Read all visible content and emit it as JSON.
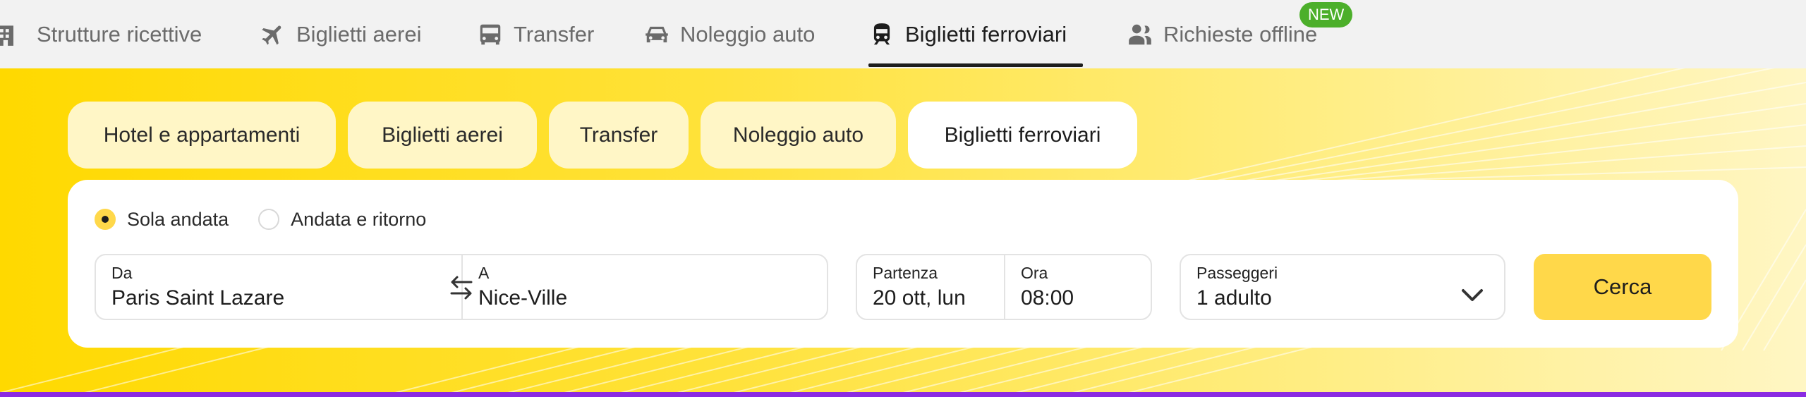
{
  "topnav": {
    "items": [
      {
        "label": "Strutture ricettive",
        "icon": "hotel-icon"
      },
      {
        "label": "Biglietti aerei",
        "icon": "airplane-icon"
      },
      {
        "label": "Transfer",
        "icon": "shuttle-icon"
      },
      {
        "label": "Noleggio auto",
        "icon": "car-icon"
      },
      {
        "label": "Biglietti ferroviari",
        "icon": "train-icon",
        "active": true
      },
      {
        "label": "Richieste offline",
        "icon": "offline-request-icon"
      }
    ],
    "new_badge": "NEW"
  },
  "tabs": [
    {
      "label": "Hotel e appartamenti"
    },
    {
      "label": "Biglietti aerei"
    },
    {
      "label": "Transfer"
    },
    {
      "label": "Noleggio auto"
    },
    {
      "label": "Biglietti ferroviari",
      "active": true
    }
  ],
  "trip_type": {
    "one_way": "Sola andata",
    "round_trip": "Andata e ritorno",
    "selected": "one_way"
  },
  "search": {
    "from_label": "Da",
    "from_value": "Paris Saint Lazare",
    "to_label": "A",
    "to_value": "Nice-Ville",
    "departure_label": "Partenza",
    "departure_value": "20 ott, lun",
    "time_label": "Ora",
    "time_value": "08:00",
    "passengers_label": "Passeggeri",
    "passengers_value": "1 adulto",
    "submit_label": "Cerca"
  },
  "colors": {
    "accent_yellow": "#ffd84a",
    "hero_yellow": "#ffd900",
    "new_badge_green": "#4caf2a",
    "bottom_line_purple": "#8a2be2"
  }
}
